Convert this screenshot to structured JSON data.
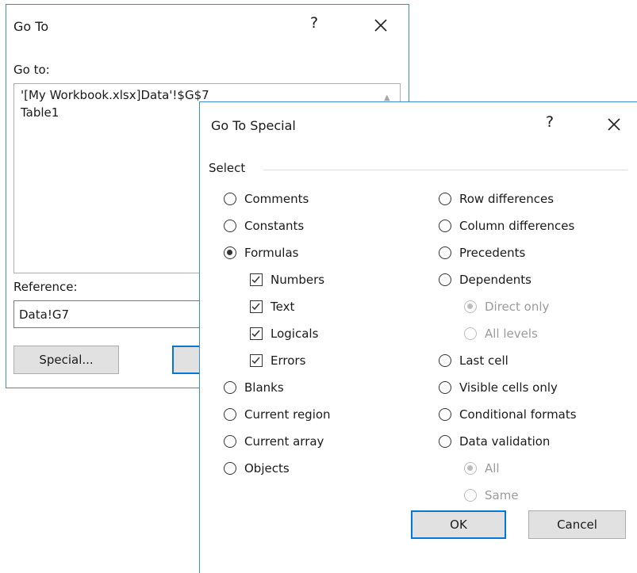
{
  "goto_dialog": {
    "title": "Go To",
    "help": "?",
    "goto_label": "Go to:",
    "list_items": [
      "'[My Workbook.xlsx]Data'!$G$7",
      "Table1"
    ],
    "reference_label": "Reference:",
    "reference_value": "Data!G7",
    "special_button": "Special..."
  },
  "special_dialog": {
    "title": "Go To Special",
    "help": "?",
    "group_label": "Select",
    "left_options": [
      {
        "label": "Comments",
        "type": "radio",
        "checked": false
      },
      {
        "label": "Constants",
        "type": "radio",
        "checked": false
      },
      {
        "label": "Formulas",
        "type": "radio",
        "checked": true
      },
      {
        "label": "Numbers",
        "type": "checkbox",
        "checked": true
      },
      {
        "label": "Text",
        "type": "checkbox",
        "checked": true
      },
      {
        "label": "Logicals",
        "type": "checkbox",
        "checked": true
      },
      {
        "label": "Errors",
        "type": "checkbox",
        "checked": true
      },
      {
        "label": "Blanks",
        "type": "radio",
        "checked": false
      },
      {
        "label": "Current region",
        "type": "radio",
        "checked": false
      },
      {
        "label": "Current array",
        "type": "radio",
        "checked": false
      },
      {
        "label": "Objects",
        "type": "radio",
        "checked": false
      }
    ],
    "right_options": [
      {
        "label": "Row differences",
        "type": "radio",
        "checked": false
      },
      {
        "label": "Column differences",
        "type": "radio",
        "checked": false
      },
      {
        "label": "Precedents",
        "type": "radio",
        "checked": false
      },
      {
        "label": "Dependents",
        "type": "radio",
        "checked": false
      },
      {
        "label": "Direct only",
        "type": "radio",
        "checked": true,
        "disabled": true
      },
      {
        "label": "All levels",
        "type": "radio",
        "checked": false,
        "disabled": true
      },
      {
        "label": "Last cell",
        "type": "radio",
        "checked": false
      },
      {
        "label": "Visible cells only",
        "type": "radio",
        "checked": false
      },
      {
        "label": "Conditional formats",
        "type": "radio",
        "checked": false
      },
      {
        "label": "Data validation",
        "type": "radio",
        "checked": false
      },
      {
        "label": "All",
        "type": "radio",
        "checked": true,
        "disabled": true
      },
      {
        "label": "Same",
        "type": "radio",
        "checked": false,
        "disabled": true
      }
    ],
    "ok_button": "OK",
    "cancel_button": "Cancel"
  },
  "colors": {
    "border": "#3c8bd6",
    "default_button": "#0078d7"
  },
  "icons": {
    "close": "close-icon",
    "help": "help-icon",
    "scroll_up": "scroll-up-icon"
  }
}
